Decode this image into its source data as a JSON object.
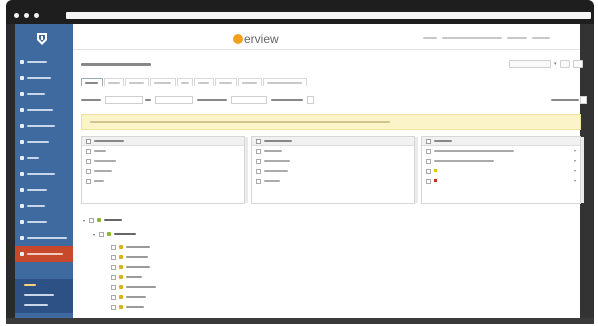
{
  "app": {
    "brand_rest": "erview"
  },
  "colors": {
    "sidebar": "#3f6aa0",
    "sidebar_active": "#c8482c",
    "brand_accent": "#f2a11e",
    "banner": "#fbf4c8",
    "folder_green": "#8db733",
    "folder_yellow": "#d9b219",
    "status_yellow": "#e6c200",
    "status_red": "#cc2a1a"
  },
  "icons": {
    "logo": "shield-logo-icon",
    "folder": "folder-icon",
    "expand": "chevron-down-icon",
    "dropdown": "caret-down-icon"
  },
  "sidebar": {
    "items": [
      "",
      "",
      "",
      "",
      "",
      "",
      "",
      "",
      "",
      "",
      "",
      "",
      ""
    ],
    "subitems": [
      "",
      "",
      ""
    ]
  }
}
